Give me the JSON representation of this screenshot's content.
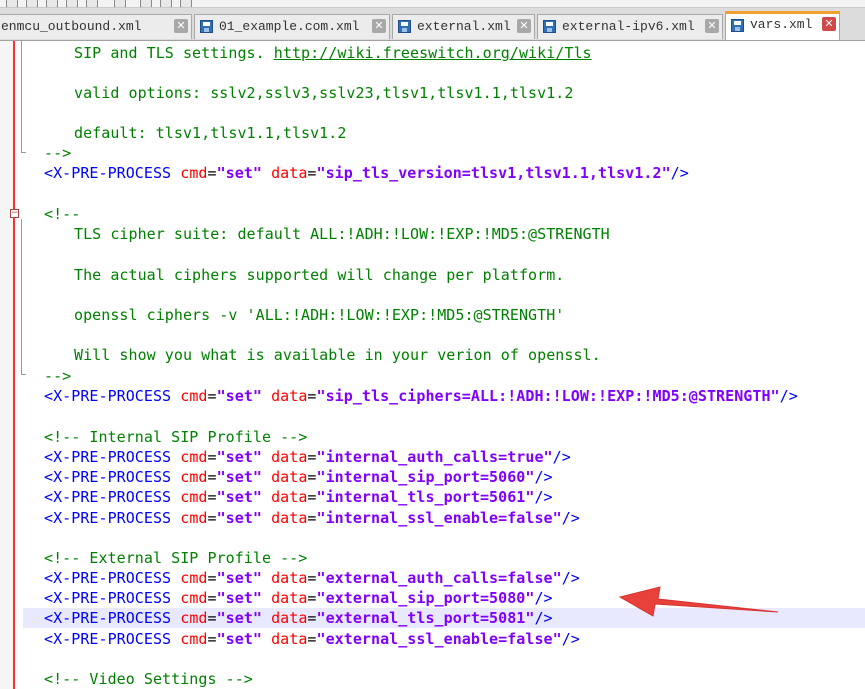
{
  "tabs": [
    {
      "label": "enmcu_outbound.xml",
      "active": false,
      "icon": "save-icon"
    },
    {
      "label": "01_example.com.xml",
      "active": false,
      "icon": "save-icon"
    },
    {
      "label": "external.xml",
      "active": false,
      "icon": "save-icon"
    },
    {
      "label": "external-ipv6.xml",
      "active": false,
      "icon": "save-icon"
    },
    {
      "label": "vars.xml",
      "active": true,
      "icon": "save-icon"
    }
  ],
  "tab_close_glyph": "✕",
  "colors": {
    "comment": "#008000",
    "tag": "#0000ff",
    "attribute": "#ff0000",
    "value": "#8000ff",
    "active_tab_accent": "#f0a030",
    "annotation_arrow": "#e8413c",
    "current_line": "#e8e8ff"
  },
  "code": {
    "tls_comment": {
      "desc_prefix": "SIP and TLS settings. ",
      "desc_link": "http://wiki.freeswitch.org/wiki/Tls",
      "options": "valid options: sslv2,sslv3,sslv23,tlsv1,tlsv1.1,tlsv1.2",
      "default": "default: tlsv1,tlsv1.1,tlsv1.2",
      "close": "-->"
    },
    "tag": "<X-PRE-PROCESS",
    "cmd_attr": "cmd",
    "cmd_value": "\"set\"",
    "data_attr": "data",
    "equals": "=",
    "self_close": "/>",
    "tls_version_value": "\"sip_tls_version=tlsv1,tlsv1.1,tlsv1.2\"",
    "cipher_comment": {
      "open": "<!--",
      "line1": "TLS cipher suite: default ALL:!ADH:!LOW:!EXP:!MD5:@STRENGTH",
      "line2": "The actual ciphers supported will change per platform.",
      "line3": "openssl ciphers -v 'ALL:!ADH:!LOW:!EXP:!MD5:@STRENGTH'",
      "line4": "Will show you what is available in your verion of openssl.",
      "close": "-->"
    },
    "tls_ciphers_value": "\"sip_tls_ciphers=ALL:!ADH:!LOW:!EXP:!MD5:@STRENGTH\"",
    "internal_comment": "<!-- Internal SIP Profile -->",
    "internal_values": [
      "\"internal_auth_calls=true\"",
      "\"internal_sip_port=5060\"",
      "\"internal_tls_port=5061\"",
      "\"internal_ssl_enable=false\""
    ],
    "external_comment": "<!-- External SIP Profile -->",
    "external_values": [
      "\"external_auth_calls=false\"",
      "\"external_sip_port=5080\"",
      "\"external_tls_port=5081\"",
      "\"external_ssl_enable=false\""
    ],
    "video_comment": "<!-- Video Settings -->"
  }
}
